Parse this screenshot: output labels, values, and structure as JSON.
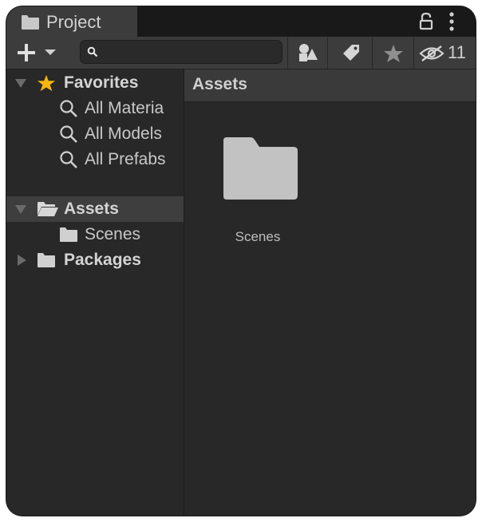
{
  "window": {
    "tab_title": "Project",
    "icons": [
      "folder-icon",
      "lock-icon",
      "kebab-menu-icon"
    ]
  },
  "toolbar": {
    "add_icon": "plus-icon",
    "search": {
      "value": "",
      "placeholder": ""
    },
    "buttons": [
      "search-by-type",
      "search-by-label",
      "save-search-favorite"
    ],
    "hidden_packages_count": "11"
  },
  "tree": {
    "favorites": {
      "label": "Favorites",
      "items": [
        "All Materia",
        "All Models",
        "All Prefabs"
      ]
    },
    "assets": {
      "label": "Assets",
      "children": [
        "Scenes"
      ]
    },
    "packages": {
      "label": "Packages"
    }
  },
  "content": {
    "breadcrumb": "Assets",
    "items": [
      {
        "name": "Scenes",
        "kind": "folder"
      }
    ]
  },
  "colors": {
    "window_bg": "#282828",
    "toolbar_bg": "#3c3c3c",
    "selected_row": "#3e3e3e",
    "favorite_star": "#f5b60f",
    "folder": "#c2c2c2"
  }
}
